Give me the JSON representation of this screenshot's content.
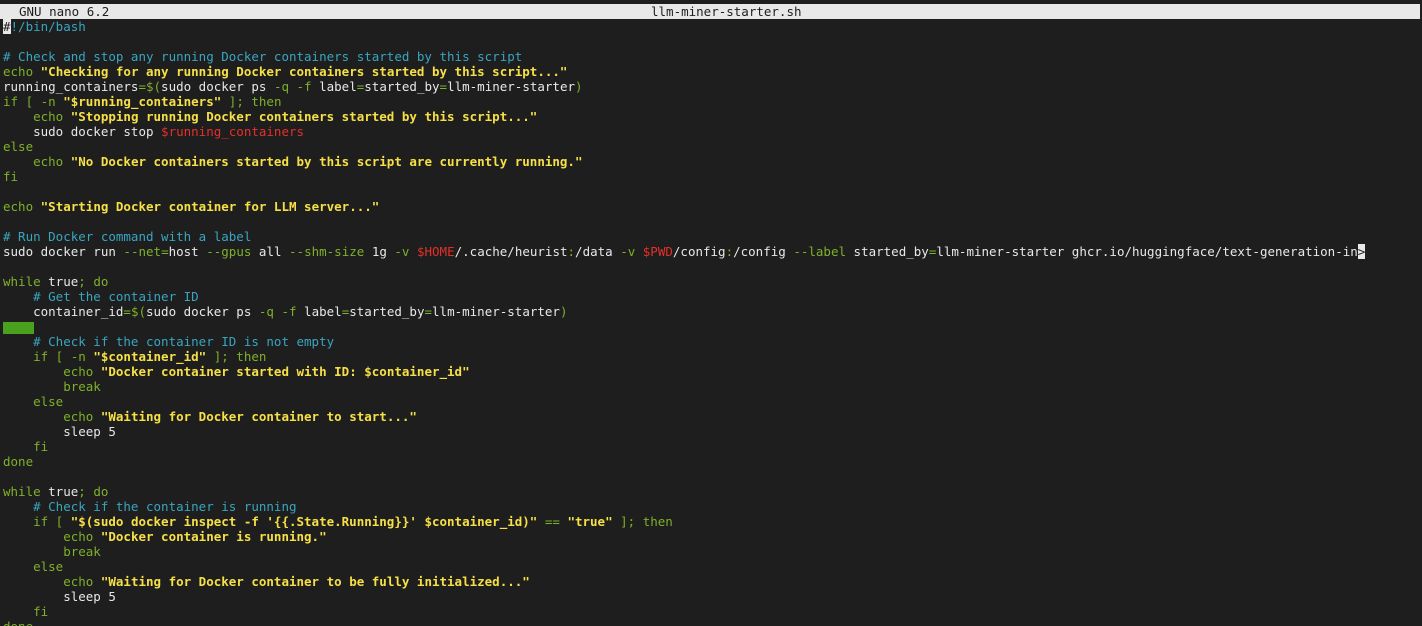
{
  "titlebar": {
    "app": "GNU nano 6.2",
    "filename": "llm-miner-starter.sh"
  },
  "lines": [
    [
      {
        "t": "#",
        "c": "cursor"
      },
      {
        "t": "!/bin/bash",
        "c": "comment"
      }
    ],
    [],
    [
      {
        "t": "# Check and stop any running Docker containers started by this script",
        "c": "comment"
      }
    ],
    [
      {
        "t": "echo ",
        "c": "kw"
      },
      {
        "t": "\"Checking for any running Docker containers started by this script...\"",
        "c": "str"
      }
    ],
    [
      {
        "t": "running_containers",
        "c": "plain"
      },
      {
        "t": "=$(",
        "c": "op"
      },
      {
        "t": "sudo docker ps ",
        "c": "plain"
      },
      {
        "t": "-q -f ",
        "c": "op"
      },
      {
        "t": "label",
        "c": "plain"
      },
      {
        "t": "=",
        "c": "op"
      },
      {
        "t": "started_by",
        "c": "plain"
      },
      {
        "t": "=",
        "c": "op"
      },
      {
        "t": "llm-miner-starter",
        "c": "plain"
      },
      {
        "t": ")",
        "c": "op"
      }
    ],
    [
      {
        "t": "if [ -n ",
        "c": "kw"
      },
      {
        "t": "\"$running_containers\"",
        "c": "str"
      },
      {
        "t": " ]; then",
        "c": "kw"
      }
    ],
    [
      {
        "t": "    echo ",
        "c": "kw"
      },
      {
        "t": "\"Stopping running Docker containers started by this script...\"",
        "c": "str"
      }
    ],
    [
      {
        "t": "    sudo docker stop ",
        "c": "plain"
      },
      {
        "t": "$running_containers",
        "c": "var"
      }
    ],
    [
      {
        "t": "else",
        "c": "kw"
      }
    ],
    [
      {
        "t": "    echo ",
        "c": "kw"
      },
      {
        "t": "\"No Docker containers started by this script are currently running.\"",
        "c": "str"
      }
    ],
    [
      {
        "t": "fi",
        "c": "kw"
      }
    ],
    [],
    [
      {
        "t": "echo ",
        "c": "kw"
      },
      {
        "t": "\"Starting Docker container for LLM server...\"",
        "c": "str"
      }
    ],
    [],
    [
      {
        "t": "# Run Docker command with a label",
        "c": "comment"
      }
    ],
    [
      {
        "t": "sudo docker run ",
        "c": "plain"
      },
      {
        "t": "--net",
        "c": "op"
      },
      {
        "t": "=",
        "c": "op"
      },
      {
        "t": "host ",
        "c": "plain"
      },
      {
        "t": "--gpus ",
        "c": "op"
      },
      {
        "t": "all ",
        "c": "plain"
      },
      {
        "t": "--shm-size ",
        "c": "op"
      },
      {
        "t": "1g ",
        "c": "plain"
      },
      {
        "t": "-v ",
        "c": "op"
      },
      {
        "t": "$HOME",
        "c": "var"
      },
      {
        "t": "/.cache/heurist",
        "c": "plain"
      },
      {
        "t": ":",
        "c": "op"
      },
      {
        "t": "/data ",
        "c": "plain"
      },
      {
        "t": "-v ",
        "c": "op"
      },
      {
        "t": "$PWD",
        "c": "var"
      },
      {
        "t": "/config",
        "c": "plain"
      },
      {
        "t": ":",
        "c": "op"
      },
      {
        "t": "/config ",
        "c": "plain"
      },
      {
        "t": "--label ",
        "c": "op"
      },
      {
        "t": "started_by",
        "c": "plain"
      },
      {
        "t": "=",
        "c": "op"
      },
      {
        "t": "llm-miner-starter ghcr.io/huggingface/text-generation-in",
        "c": "plain"
      },
      {
        "t": ">",
        "c": "overflow-marker"
      }
    ],
    [],
    [
      {
        "t": "while ",
        "c": "kw"
      },
      {
        "t": "true",
        "c": "plain"
      },
      {
        "t": "; do",
        "c": "kw"
      }
    ],
    [
      {
        "t": "    # Get the container ID",
        "c": "comment"
      }
    ],
    [
      {
        "t": "    container_id",
        "c": "plain"
      },
      {
        "t": "=$(",
        "c": "op"
      },
      {
        "t": "sudo docker ps ",
        "c": "plain"
      },
      {
        "t": "-q -f ",
        "c": "op"
      },
      {
        "t": "label",
        "c": "plain"
      },
      {
        "t": "=",
        "c": "op"
      },
      {
        "t": "started_by",
        "c": "plain"
      },
      {
        "t": "=",
        "c": "op"
      },
      {
        "t": "llm-miner-starter",
        "c": "plain"
      },
      {
        "t": ")",
        "c": "op"
      }
    ],
    [
      {
        "t": "",
        "c": "trail"
      }
    ],
    [
      {
        "t": "    # Check if the container ID is not empty",
        "c": "comment"
      }
    ],
    [
      {
        "t": "    if [ -n ",
        "c": "kw"
      },
      {
        "t": "\"$container_id\"",
        "c": "str"
      },
      {
        "t": " ]; then",
        "c": "kw"
      }
    ],
    [
      {
        "t": "        echo ",
        "c": "kw"
      },
      {
        "t": "\"Docker container started with ID: $container_id\"",
        "c": "str"
      }
    ],
    [
      {
        "t": "        break",
        "c": "kw"
      }
    ],
    [
      {
        "t": "    else",
        "c": "kw"
      }
    ],
    [
      {
        "t": "        echo ",
        "c": "kw"
      },
      {
        "t": "\"Waiting for Docker container to start...\"",
        "c": "str"
      }
    ],
    [
      {
        "t": "        sleep 5",
        "c": "plain"
      }
    ],
    [
      {
        "t": "    fi",
        "c": "kw"
      }
    ],
    [
      {
        "t": "done",
        "c": "kw"
      }
    ],
    [],
    [
      {
        "t": "while ",
        "c": "kw"
      },
      {
        "t": "true",
        "c": "plain"
      },
      {
        "t": "; do",
        "c": "kw"
      }
    ],
    [
      {
        "t": "    # Check if the container is running",
        "c": "comment"
      }
    ],
    [
      {
        "t": "    if [ ",
        "c": "kw"
      },
      {
        "t": "\"$(sudo docker inspect -f '{{.State.Running}}' $container_id)\"",
        "c": "str"
      },
      {
        "t": " == ",
        "c": "kw"
      },
      {
        "t": "\"true\"",
        "c": "str"
      },
      {
        "t": " ]; then",
        "c": "kw"
      }
    ],
    [
      {
        "t": "        echo ",
        "c": "kw"
      },
      {
        "t": "\"Docker container is running.\"",
        "c": "str"
      }
    ],
    [
      {
        "t": "        break",
        "c": "kw"
      }
    ],
    [
      {
        "t": "    else",
        "c": "kw"
      }
    ],
    [
      {
        "t": "        echo ",
        "c": "kw"
      },
      {
        "t": "\"Waiting for Docker container to be fully initialized...\"",
        "c": "str"
      }
    ],
    [
      {
        "t": "        sleep 5",
        "c": "plain"
      }
    ],
    [
      {
        "t": "    fi",
        "c": "kw"
      }
    ],
    [
      {
        "t": "done",
        "c": "kw"
      }
    ]
  ],
  "colors": {
    "background": "#1e1e1e",
    "titlebar": "#e8e8e8",
    "comment": "#3aa5c0",
    "keyword": "#7fb12a",
    "string": "#f6e046",
    "variable": "#e5302a",
    "trailing_whitespace": "#4aa11e"
  }
}
